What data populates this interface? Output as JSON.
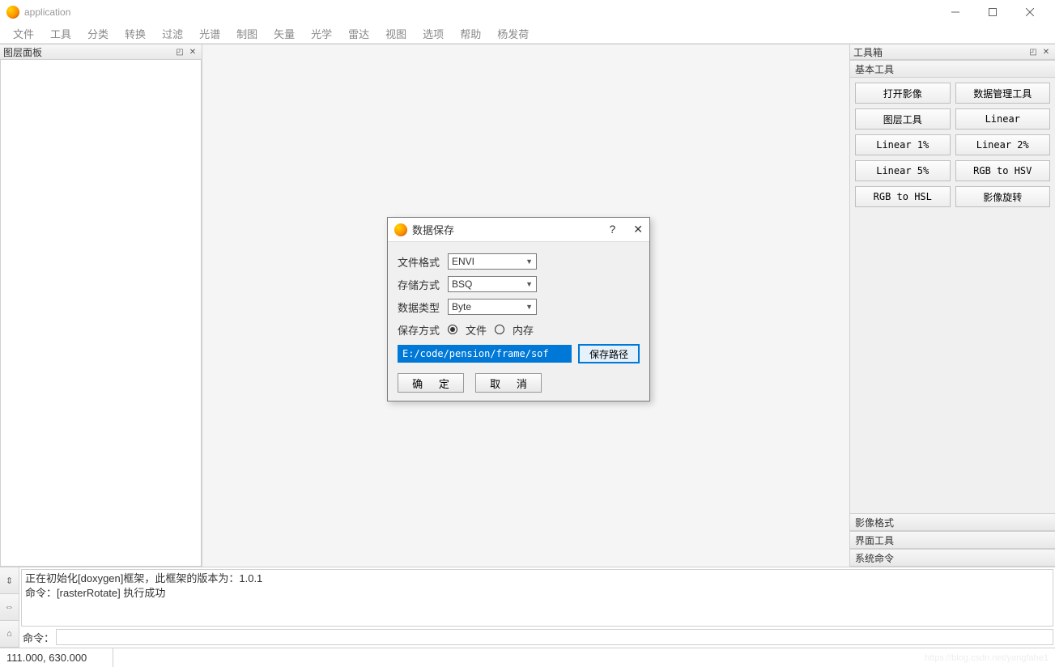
{
  "window": {
    "title": "application"
  },
  "menu": [
    "文件",
    "工具",
    "分类",
    "转换",
    "过滤",
    "光谱",
    "制图",
    "矢量",
    "光学",
    "雷达",
    "视图",
    "选项",
    "帮助",
    "杨发荷"
  ],
  "left_panel": {
    "title": "图层面板"
  },
  "right_panel": {
    "title": "工具箱",
    "sections": {
      "basic_tools": "基本工具",
      "image_format": "影像格式",
      "ui_tools": "界面工具",
      "sys_cmd": "系统命令"
    },
    "buttons": [
      "打开影像",
      "数据管理工具",
      "图层工具",
      "Linear",
      "Linear 1%",
      "Linear 2%",
      "Linear 5%",
      "RGB to HSV",
      "RGB to HSL",
      "影像旋转"
    ]
  },
  "log": {
    "line1": "正在初始化[doxygen]框架，此框架的版本为：1.0.1",
    "line2": "命令：[rasterRotate] 执行成功",
    "cmd_label": "命令："
  },
  "status": {
    "coords": "111.000, 630.000"
  },
  "dialog": {
    "title": "数据保存",
    "help": "?",
    "labels": {
      "format": "文件格式",
      "storage": "存储方式",
      "dtype": "数据类型",
      "save_mode": "保存方式"
    },
    "values": {
      "format": "ENVI",
      "storage": "BSQ",
      "dtype": "Byte"
    },
    "radios": {
      "file": "文件",
      "memory": "内存"
    },
    "path_value": "E:/code/pension/frame/sof",
    "path_btn": "保存路径",
    "ok": "确 定",
    "cancel": "取 消"
  },
  "watermark": "https://blog.csdn.net/yangfahe1"
}
